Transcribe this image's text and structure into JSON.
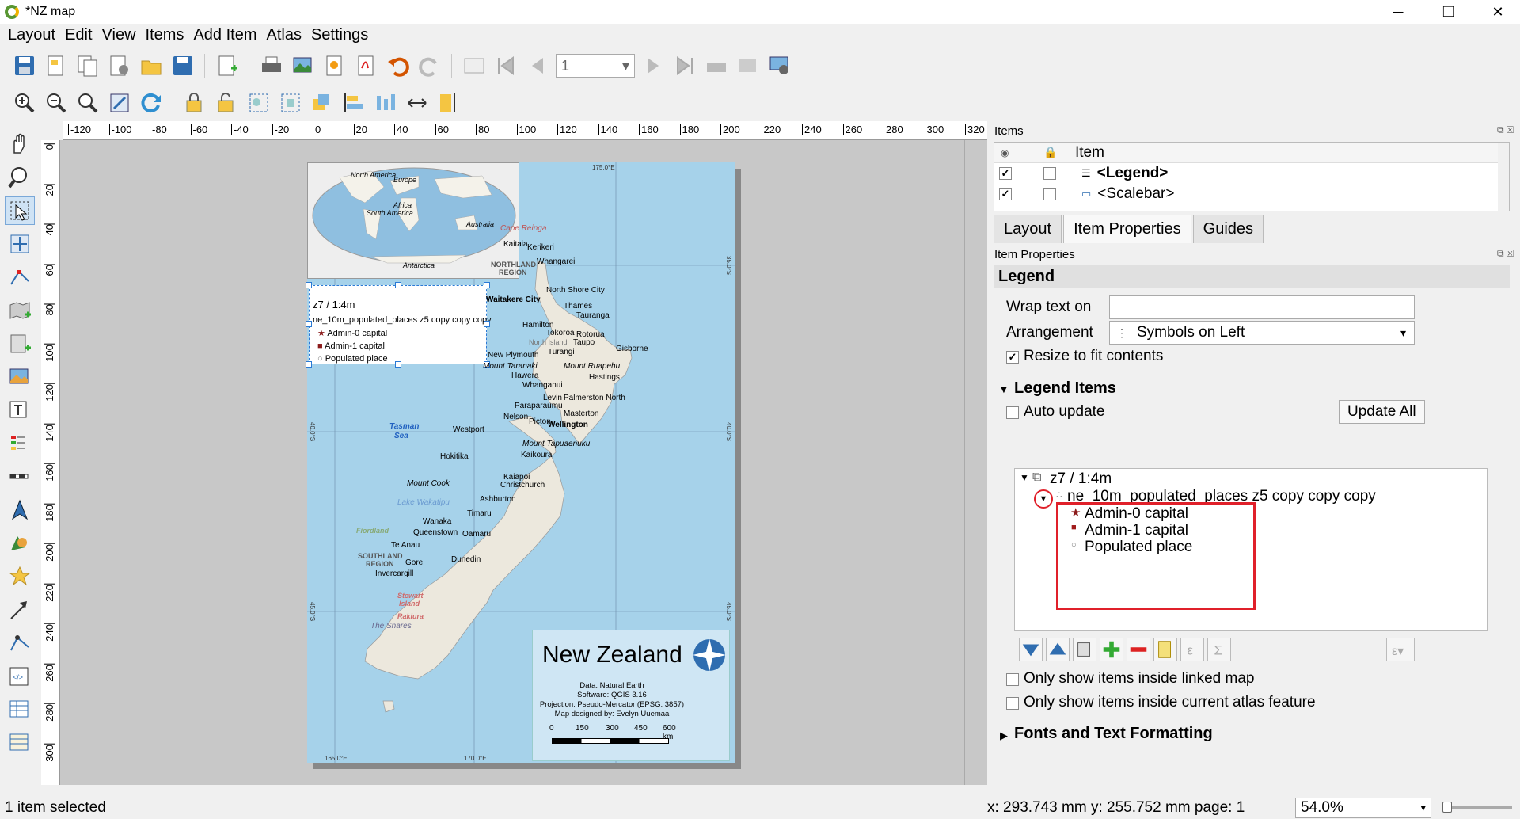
{
  "window": {
    "title": "*NZ map"
  },
  "menu": [
    "Layout",
    "Edit",
    "View",
    "Items",
    "Add Item",
    "Atlas",
    "Settings"
  ],
  "toolbar": {
    "page_value": "1"
  },
  "ruler": {
    "h_ticks": [
      "-120",
      "-100",
      "-80",
      "-60",
      "-40",
      "-20",
      "0",
      "20",
      "40",
      "60",
      "80",
      "100",
      "120",
      "140",
      "160",
      "180",
      "200",
      "220",
      "240",
      "260",
      "280",
      "300",
      "320"
    ],
    "v_ticks": [
      "0",
      "20",
      "40",
      "60",
      "80",
      "100",
      "120",
      "140",
      "160",
      "180",
      "200",
      "220",
      "240",
      "260",
      "280",
      "300"
    ]
  },
  "map": {
    "inset_labels": [
      "North America",
      "Europe",
      "Africa",
      "South America",
      "Australia",
      "Antarctica"
    ],
    "legend": {
      "title": "z7 / 1:4m",
      "layer": "ne_10m_populated_places z5 copy copy copy",
      "items": [
        "Admin-0 capital",
        "Admin-1 capital",
        "Populated place"
      ]
    },
    "title": "New Zealand",
    "info": [
      "Data: Natural Earth",
      "Software: QGIS 3.16",
      "Projection: Pseudo-Mercator (EPSG: 3857)",
      "Map designed by: Evelyn Uuemaa"
    ],
    "scale_labels": [
      "0",
      "150",
      "300",
      "450",
      "600 km"
    ],
    "coords": [
      "175.0°E",
      "35.0°S",
      "40.0°S",
      "40.0°S",
      "45.0°S",
      "45.0°S",
      "165.0°E",
      "170.0°E"
    ],
    "sea": [
      "Tasman",
      "Sea"
    ],
    "regions": [
      "NORTHLAND",
      "REGION",
      "SOUTHLAND",
      "REGION",
      "North Island",
      "Stewart",
      "Island",
      "Rakiura",
      "Fiordland"
    ],
    "places": [
      "Cape Reinga",
      "Kaitaia",
      "Kerikeri",
      "Whangarei",
      "North Shore City",
      "Waitakere City",
      "Thames",
      "Tauranga",
      "Hamilton",
      "Tokoroa",
      "Rotorua",
      "Taupo",
      "Turangi",
      "Gisborne",
      "New Plymouth",
      "Mount Taranaki",
      "Mount Ruapehu",
      "Hawera",
      "Hastings",
      "Whanganui",
      "Levin",
      "Palmerston North",
      "Paraparaumu",
      "Nelson",
      "Picton",
      "Wellington",
      "Masterton",
      "Westport",
      "Mount Tapuaenuku",
      "Kaikoura",
      "Hokitika",
      "Kaiapoi",
      "Christchurch",
      "Mount Cook",
      "Ashburton",
      "Timaru",
      "Wanaka",
      "Queenstown",
      "Oamaru",
      "Te Anau",
      "Dunedin",
      "Gore",
      "Invercargill",
      "The Snares",
      "Lake Wakatipu"
    ]
  },
  "items_panel": {
    "title": "Items",
    "header": "Item",
    "rows": [
      "<Legend>",
      "<Scalebar>"
    ]
  },
  "tabs": [
    "Layout",
    "Item Properties",
    "Guides"
  ],
  "props": {
    "title": "Item Properties",
    "section": "Legend",
    "wrap_label": "Wrap text on",
    "wrap_value": "",
    "arrangement_label": "Arrangement",
    "arrangement_value": "Symbols on Left",
    "resize_label": "Resize to fit contents",
    "legend_items_title": "Legend Items",
    "auto_update": "Auto update",
    "update_all": "Update All",
    "tree_group": "z7 / 1:4m",
    "tree_layer": "ne_10m_populated_places z5 copy copy copy",
    "tree_items": [
      "Admin-0 capital",
      "Admin-1 capital",
      "Populated place"
    ],
    "only_linked": "Only show items inside linked map",
    "only_atlas": "Only show items inside current atlas feature",
    "fonts_title": "Fonts and Text Formatting"
  },
  "status": {
    "selection": "1 item selected",
    "coords": "x: 293.743 mm y: 255.752 mm page: 1",
    "zoom": "54.0%"
  },
  "colors": {
    "highlight": "#e0202a",
    "selection": "#2a7ad5",
    "sea": "#a6d2ea"
  }
}
